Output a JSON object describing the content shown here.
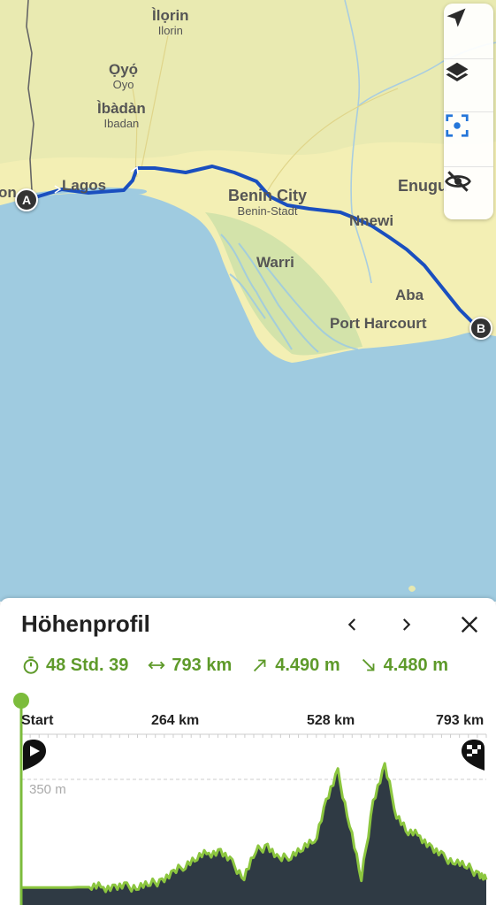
{
  "map": {
    "places": [
      {
        "id": "ilorin",
        "name": "Ìlọrin",
        "sub": "Ilorin"
      },
      {
        "id": "oyo",
        "name": "Ọyọ́",
        "sub": "Oyo"
      },
      {
        "id": "ibadan",
        "name": "Ìbàdàn",
        "sub": "Ibadan"
      },
      {
        "id": "lagos",
        "name": "Lagos",
        "sub": ""
      },
      {
        "id": "benin",
        "name": "Benin City",
        "sub": "Benin-Stadt"
      },
      {
        "id": "nnewi",
        "name": "Nnewi",
        "sub": ""
      },
      {
        "id": "enugu",
        "name": "Enugu",
        "sub": ""
      },
      {
        "id": "warri",
        "name": "Warri",
        "sub": ""
      },
      {
        "id": "aba",
        "name": "Aba",
        "sub": ""
      },
      {
        "id": "porth",
        "name": "Port Harcourt",
        "sub": ""
      },
      {
        "id": "edge",
        "name": "on",
        "sub": ""
      }
    ],
    "start_marker": "A",
    "end_marker": "B",
    "controls": [
      "navigation-arrow-icon",
      "layers-icon",
      "focus-route-icon",
      "hide-eye-icon"
    ],
    "colors": {
      "sea": "#9fcbe0",
      "land": "#f3efb4",
      "route": "#1a4fbf"
    }
  },
  "sheet": {
    "title": "Höhenprofil",
    "stats": {
      "duration": "48 Std. 39",
      "distance": "793 km",
      "ascent": "4.490 m",
      "descent": "4.480 m"
    },
    "icons": [
      "timer-icon",
      "distance-icon",
      "ascent-icon",
      "descent-icon"
    ],
    "accent": "#5e9a2a"
  },
  "chart_data": {
    "type": "area",
    "title": "",
    "xlabel": "",
    "ylabel": "",
    "x_ticks": [
      "Start",
      "264 km",
      "528 km",
      "793 km"
    ],
    "xlim": [
      0,
      793
    ],
    "y_label_max": "350 m",
    "ylim": [
      0,
      440
    ],
    "x": [
      0,
      20,
      40,
      60,
      80,
      100,
      120,
      140,
      160,
      180,
      200,
      220,
      240,
      260,
      280,
      300,
      320,
      340,
      360,
      380,
      400,
      420,
      440,
      460,
      480,
      500,
      520,
      540,
      560,
      580,
      600,
      620,
      640,
      660,
      680,
      700,
      720,
      740,
      760,
      780,
      793
    ],
    "values": [
      5,
      5,
      5,
      5,
      5,
      6,
      6,
      6,
      6,
      6,
      10,
      15,
      30,
      50,
      80,
      100,
      115,
      120,
      80,
      40,
      120,
      140,
      90,
      110,
      130,
      150,
      280,
      370,
      210,
      30,
      280,
      390,
      240,
      180,
      170,
      130,
      100,
      90,
      70,
      50,
      30
    ]
  }
}
